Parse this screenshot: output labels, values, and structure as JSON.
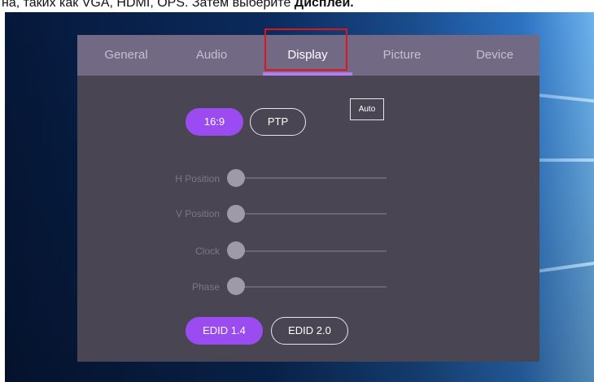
{
  "caption": {
    "text": "на, таких как VGA, HDMI, OPS. Затем выберите ",
    "bold": "Дисплей."
  },
  "tabs": [
    {
      "label": "General",
      "active": false
    },
    {
      "label": "Audio",
      "active": false
    },
    {
      "label": "Display",
      "active": true
    },
    {
      "label": "Picture",
      "active": false
    },
    {
      "label": "Device",
      "active": false
    }
  ],
  "aspect": {
    "option_1": "16:9",
    "option_2": "PTP",
    "selected": "16:9",
    "auto_label": "Auto"
  },
  "sliders": [
    {
      "label": "H Position",
      "value": 0
    },
    {
      "label": "V Position",
      "value": 0
    },
    {
      "label": "Clock",
      "value": 0
    },
    {
      "label": "Phase",
      "value": 0
    }
  ],
  "edid": {
    "option_1": "EDID 1.4",
    "option_2": "EDID 2.0",
    "selected": "EDID 1.4"
  },
  "colors": {
    "accent": "#9b4cf0",
    "tabbar": "#726a85",
    "panel": "#4a4553",
    "highlight": "#e0151b"
  }
}
